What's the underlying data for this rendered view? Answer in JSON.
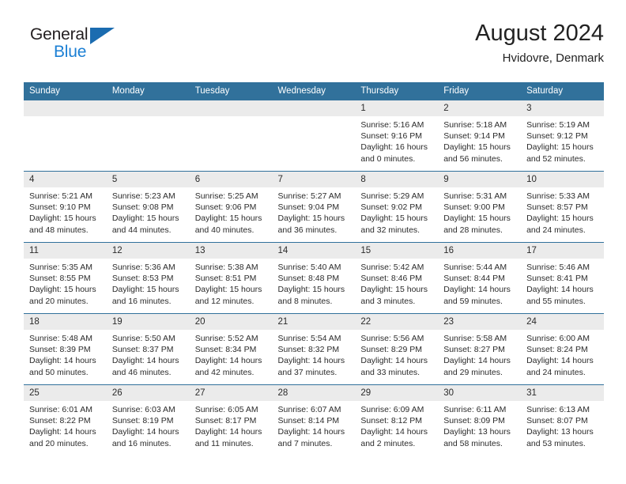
{
  "brand": {
    "line1": "General",
    "line2": "Blue",
    "triangle_color": "#1b6cb0",
    "blue_text_color": "#1b7fd4"
  },
  "header": {
    "title": "August 2024",
    "subtitle": "Hvidovre, Denmark"
  },
  "theme": {
    "header_row_bg": "#31719b",
    "header_row_text": "#ffffff",
    "daynum_bg": "#ebebeb",
    "grid_line": "#31719b",
    "body_text": "#2b2b2b"
  },
  "weekday_headers": [
    "Sunday",
    "Monday",
    "Tuesday",
    "Wednesday",
    "Thursday",
    "Friday",
    "Saturday"
  ],
  "weeks": [
    [
      {
        "day": "",
        "sunrise": "",
        "sunset": "",
        "daylight_l1": "",
        "daylight_l2": ""
      },
      {
        "day": "",
        "sunrise": "",
        "sunset": "",
        "daylight_l1": "",
        "daylight_l2": ""
      },
      {
        "day": "",
        "sunrise": "",
        "sunset": "",
        "daylight_l1": "",
        "daylight_l2": ""
      },
      {
        "day": "",
        "sunrise": "",
        "sunset": "",
        "daylight_l1": "",
        "daylight_l2": ""
      },
      {
        "day": "1",
        "sunrise": "Sunrise: 5:16 AM",
        "sunset": "Sunset: 9:16 PM",
        "daylight_l1": "Daylight: 16 hours",
        "daylight_l2": "and 0 minutes."
      },
      {
        "day": "2",
        "sunrise": "Sunrise: 5:18 AM",
        "sunset": "Sunset: 9:14 PM",
        "daylight_l1": "Daylight: 15 hours",
        "daylight_l2": "and 56 minutes."
      },
      {
        "day": "3",
        "sunrise": "Sunrise: 5:19 AM",
        "sunset": "Sunset: 9:12 PM",
        "daylight_l1": "Daylight: 15 hours",
        "daylight_l2": "and 52 minutes."
      }
    ],
    [
      {
        "day": "4",
        "sunrise": "Sunrise: 5:21 AM",
        "sunset": "Sunset: 9:10 PM",
        "daylight_l1": "Daylight: 15 hours",
        "daylight_l2": "and 48 minutes."
      },
      {
        "day": "5",
        "sunrise": "Sunrise: 5:23 AM",
        "sunset": "Sunset: 9:08 PM",
        "daylight_l1": "Daylight: 15 hours",
        "daylight_l2": "and 44 minutes."
      },
      {
        "day": "6",
        "sunrise": "Sunrise: 5:25 AM",
        "sunset": "Sunset: 9:06 PM",
        "daylight_l1": "Daylight: 15 hours",
        "daylight_l2": "and 40 minutes."
      },
      {
        "day": "7",
        "sunrise": "Sunrise: 5:27 AM",
        "sunset": "Sunset: 9:04 PM",
        "daylight_l1": "Daylight: 15 hours",
        "daylight_l2": "and 36 minutes."
      },
      {
        "day": "8",
        "sunrise": "Sunrise: 5:29 AM",
        "sunset": "Sunset: 9:02 PM",
        "daylight_l1": "Daylight: 15 hours",
        "daylight_l2": "and 32 minutes."
      },
      {
        "day": "9",
        "sunrise": "Sunrise: 5:31 AM",
        "sunset": "Sunset: 9:00 PM",
        "daylight_l1": "Daylight: 15 hours",
        "daylight_l2": "and 28 minutes."
      },
      {
        "day": "10",
        "sunrise": "Sunrise: 5:33 AM",
        "sunset": "Sunset: 8:57 PM",
        "daylight_l1": "Daylight: 15 hours",
        "daylight_l2": "and 24 minutes."
      }
    ],
    [
      {
        "day": "11",
        "sunrise": "Sunrise: 5:35 AM",
        "sunset": "Sunset: 8:55 PM",
        "daylight_l1": "Daylight: 15 hours",
        "daylight_l2": "and 20 minutes."
      },
      {
        "day": "12",
        "sunrise": "Sunrise: 5:36 AM",
        "sunset": "Sunset: 8:53 PM",
        "daylight_l1": "Daylight: 15 hours",
        "daylight_l2": "and 16 minutes."
      },
      {
        "day": "13",
        "sunrise": "Sunrise: 5:38 AM",
        "sunset": "Sunset: 8:51 PM",
        "daylight_l1": "Daylight: 15 hours",
        "daylight_l2": "and 12 minutes."
      },
      {
        "day": "14",
        "sunrise": "Sunrise: 5:40 AM",
        "sunset": "Sunset: 8:48 PM",
        "daylight_l1": "Daylight: 15 hours",
        "daylight_l2": "and 8 minutes."
      },
      {
        "day": "15",
        "sunrise": "Sunrise: 5:42 AM",
        "sunset": "Sunset: 8:46 PM",
        "daylight_l1": "Daylight: 15 hours",
        "daylight_l2": "and 3 minutes."
      },
      {
        "day": "16",
        "sunrise": "Sunrise: 5:44 AM",
        "sunset": "Sunset: 8:44 PM",
        "daylight_l1": "Daylight: 14 hours",
        "daylight_l2": "and 59 minutes."
      },
      {
        "day": "17",
        "sunrise": "Sunrise: 5:46 AM",
        "sunset": "Sunset: 8:41 PM",
        "daylight_l1": "Daylight: 14 hours",
        "daylight_l2": "and 55 minutes."
      }
    ],
    [
      {
        "day": "18",
        "sunrise": "Sunrise: 5:48 AM",
        "sunset": "Sunset: 8:39 PM",
        "daylight_l1": "Daylight: 14 hours",
        "daylight_l2": "and 50 minutes."
      },
      {
        "day": "19",
        "sunrise": "Sunrise: 5:50 AM",
        "sunset": "Sunset: 8:37 PM",
        "daylight_l1": "Daylight: 14 hours",
        "daylight_l2": "and 46 minutes."
      },
      {
        "day": "20",
        "sunrise": "Sunrise: 5:52 AM",
        "sunset": "Sunset: 8:34 PM",
        "daylight_l1": "Daylight: 14 hours",
        "daylight_l2": "and 42 minutes."
      },
      {
        "day": "21",
        "sunrise": "Sunrise: 5:54 AM",
        "sunset": "Sunset: 8:32 PM",
        "daylight_l1": "Daylight: 14 hours",
        "daylight_l2": "and 37 minutes."
      },
      {
        "day": "22",
        "sunrise": "Sunrise: 5:56 AM",
        "sunset": "Sunset: 8:29 PM",
        "daylight_l1": "Daylight: 14 hours",
        "daylight_l2": "and 33 minutes."
      },
      {
        "day": "23",
        "sunrise": "Sunrise: 5:58 AM",
        "sunset": "Sunset: 8:27 PM",
        "daylight_l1": "Daylight: 14 hours",
        "daylight_l2": "and 29 minutes."
      },
      {
        "day": "24",
        "sunrise": "Sunrise: 6:00 AM",
        "sunset": "Sunset: 8:24 PM",
        "daylight_l1": "Daylight: 14 hours",
        "daylight_l2": "and 24 minutes."
      }
    ],
    [
      {
        "day": "25",
        "sunrise": "Sunrise: 6:01 AM",
        "sunset": "Sunset: 8:22 PM",
        "daylight_l1": "Daylight: 14 hours",
        "daylight_l2": "and 20 minutes."
      },
      {
        "day": "26",
        "sunrise": "Sunrise: 6:03 AM",
        "sunset": "Sunset: 8:19 PM",
        "daylight_l1": "Daylight: 14 hours",
        "daylight_l2": "and 16 minutes."
      },
      {
        "day": "27",
        "sunrise": "Sunrise: 6:05 AM",
        "sunset": "Sunset: 8:17 PM",
        "daylight_l1": "Daylight: 14 hours",
        "daylight_l2": "and 11 minutes."
      },
      {
        "day": "28",
        "sunrise": "Sunrise: 6:07 AM",
        "sunset": "Sunset: 8:14 PM",
        "daylight_l1": "Daylight: 14 hours",
        "daylight_l2": "and 7 minutes."
      },
      {
        "day": "29",
        "sunrise": "Sunrise: 6:09 AM",
        "sunset": "Sunset: 8:12 PM",
        "daylight_l1": "Daylight: 14 hours",
        "daylight_l2": "and 2 minutes."
      },
      {
        "day": "30",
        "sunrise": "Sunrise: 6:11 AM",
        "sunset": "Sunset: 8:09 PM",
        "daylight_l1": "Daylight: 13 hours",
        "daylight_l2": "and 58 minutes."
      },
      {
        "day": "31",
        "sunrise": "Sunrise: 6:13 AM",
        "sunset": "Sunset: 8:07 PM",
        "daylight_l1": "Daylight: 13 hours",
        "daylight_l2": "and 53 minutes."
      }
    ]
  ]
}
